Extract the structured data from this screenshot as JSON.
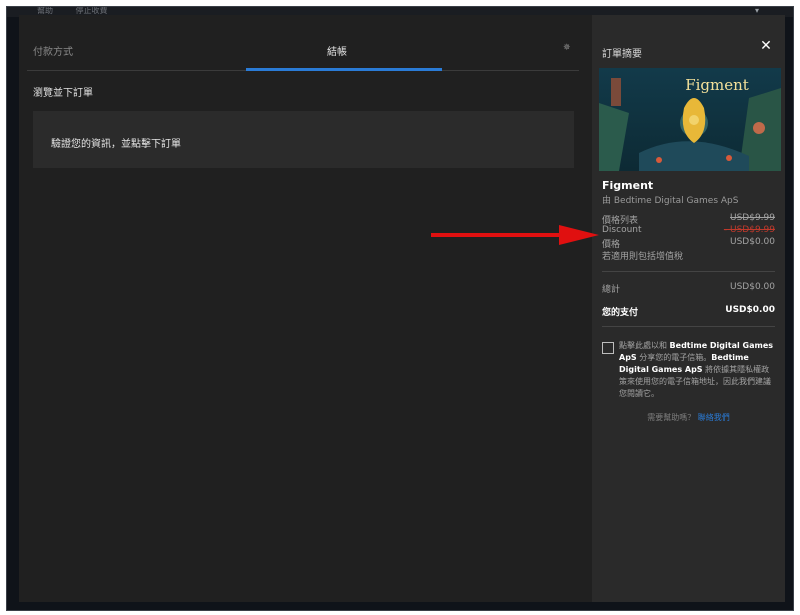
{
  "top_strip": {
    "items": [
      "幫助",
      "停止收費"
    ]
  },
  "tabs": {
    "payment": "付款方式",
    "checkout": "結帳"
  },
  "main": {
    "review_heading": "瀏覽並下訂單",
    "verify_text": "驗證您的資訊，並點擊下訂單"
  },
  "summary": {
    "title": "訂單摘要",
    "close_icon": "close-icon",
    "cover_title": "Figment",
    "game_title": "Figment",
    "publisher": "由 Bedtime Digital Games ApS",
    "list_price_label": "價格列表",
    "list_price_value": "USD$9.99",
    "discount_label": "Discount",
    "discount_value": "- USD$9.99",
    "price_label": "價格",
    "price_value": "USD$0.00",
    "tax_note": "若適用則包括增值稅",
    "subtotal_label": "總計",
    "subtotal_value": "USD$0.00",
    "pay_label": "您的支付",
    "pay_value": "USD$0.00",
    "consent_1": "點擊此處以和 ",
    "consent_2": "Bedtime Digital Games ApS",
    "consent_3": " 分享您的電子信箱。",
    "consent_4": "Bedtime Digital Games ApS",
    "consent_5": " 將依據其隱私權政策來使用您的電子信箱地址，因此我們建議您閱讀它。",
    "help_text": "需要幫助嗎？",
    "help_link": "聯絡我們"
  },
  "colors": {
    "accent": "#2a7bd6",
    "discount": "#c0392b",
    "arrow": "#e01010"
  }
}
